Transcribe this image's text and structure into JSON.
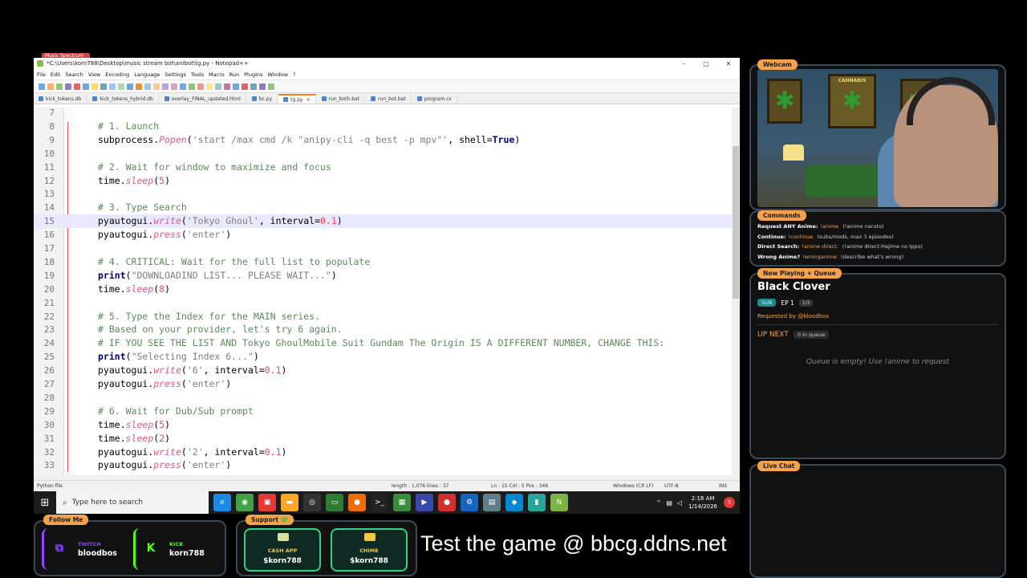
{
  "notepad": {
    "title": "*C:\\Users\\korn788\\Desktop\\music stream bot\\anibot\\tg.py - Notepad++",
    "menu": [
      "File",
      "Edit",
      "Search",
      "View",
      "Encoding",
      "Language",
      "Settings",
      "Tools",
      "Macro",
      "Run",
      "Plugins",
      "Window",
      "?"
    ],
    "tabs": [
      "kick_tokens.db",
      "kick_tokens_hybrid.db",
      "overlay_FINAL_updated.html",
      "bc.py",
      "tg.py",
      "run_both.bat",
      "run_bot.bat",
      "program.cs"
    ],
    "active_tab": "tg.py",
    "status": {
      "file_type": "Python file",
      "length": "length : 1,076    lines : 37",
      "position": "Ln : 15    Col : 5    Pos : 349",
      "eol": "Windows (CR LF)",
      "encoding": "UTF-8",
      "mode": "INS"
    }
  },
  "code": [
    {
      "n": "7",
      "parts": []
    },
    {
      "n": "8",
      "parts": [
        [
          "c-com",
          "# 1. Launch"
        ]
      ]
    },
    {
      "n": "9",
      "parts": [
        [
          "",
          "subprocess."
        ],
        [
          "c-fn",
          "Popen"
        ],
        [
          "",
          "("
        ],
        [
          "c-str",
          "'start /max cmd /k \"anipy-cli -q best -p mpv\"'"
        ],
        [
          "",
          ", shell="
        ],
        [
          "c-kw",
          "True"
        ],
        [
          "",
          ")"
        ]
      ]
    },
    {
      "n": "10",
      "parts": []
    },
    {
      "n": "11",
      "parts": [
        [
          "c-com",
          "# 2. Wait for window to maximize and focus"
        ]
      ]
    },
    {
      "n": "12",
      "parts": [
        [
          "",
          "time."
        ],
        [
          "c-fn",
          "sleep"
        ],
        [
          "",
          "("
        ],
        [
          "c-num",
          "5"
        ],
        [
          "",
          ")"
        ]
      ]
    },
    {
      "n": "13",
      "parts": []
    },
    {
      "n": "14",
      "parts": [
        [
          "c-com",
          "# 3. Type Search"
        ]
      ]
    },
    {
      "n": "15",
      "parts": [
        [
          "",
          "pyautogui."
        ],
        [
          "c-fn",
          "write"
        ],
        [
          "",
          "("
        ],
        [
          "c-str",
          "'Tokyo Ghoul'"
        ],
        [
          "",
          ", interval="
        ],
        [
          "c-num",
          "0.1"
        ],
        [
          "",
          ")"
        ]
      ],
      "current": true
    },
    {
      "n": "16",
      "parts": [
        [
          "",
          "pyautogui."
        ],
        [
          "c-fn",
          "press"
        ],
        [
          "",
          "("
        ],
        [
          "c-str",
          "'enter'"
        ],
        [
          "",
          ")"
        ]
      ]
    },
    {
      "n": "17",
      "parts": []
    },
    {
      "n": "18",
      "parts": [
        [
          "c-com",
          "# 4. CRITICAL: Wait for the full list to populate"
        ]
      ]
    },
    {
      "n": "19",
      "parts": [
        [
          "c-kw",
          "print"
        ],
        [
          "",
          "("
        ],
        [
          "c-str",
          "\"DOWNLOADIND LIST... PLEASE WAIT...\""
        ],
        [
          "",
          ")"
        ]
      ]
    },
    {
      "n": "20",
      "parts": [
        [
          "",
          "time."
        ],
        [
          "c-fn",
          "sleep"
        ],
        [
          "",
          "("
        ],
        [
          "c-num",
          "8"
        ],
        [
          "",
          ")"
        ]
      ]
    },
    {
      "n": "21",
      "parts": []
    },
    {
      "n": "22",
      "parts": [
        [
          "c-com",
          "# 5. Type the Index for the MAIN series."
        ]
      ]
    },
    {
      "n": "23",
      "parts": [
        [
          "c-com",
          "# Based on your provider, let's try 6 again."
        ]
      ]
    },
    {
      "n": "24",
      "parts": [
        [
          "c-com",
          "# IF YOU SEE THE LIST AND Tokyo GhoulMobile Suit Gundam The Origin IS A DIFFERENT NUMBER, CHANGE THIS:"
        ]
      ]
    },
    {
      "n": "25",
      "parts": [
        [
          "c-kw",
          "print"
        ],
        [
          "",
          "("
        ],
        [
          "c-str",
          "\"Selecting Index 6...\""
        ],
        [
          "",
          ")"
        ]
      ]
    },
    {
      "n": "26",
      "parts": [
        [
          "",
          "pyautogui."
        ],
        [
          "c-fn",
          "write"
        ],
        [
          "",
          "("
        ],
        [
          "c-str",
          "'6'"
        ],
        [
          "",
          ", interval="
        ],
        [
          "c-num",
          "0.1"
        ],
        [
          "",
          ")"
        ]
      ]
    },
    {
      "n": "27",
      "parts": [
        [
          "",
          "pyautogui."
        ],
        [
          "c-fn",
          "press"
        ],
        [
          "",
          "("
        ],
        [
          "c-str",
          "'enter'"
        ],
        [
          "",
          ")"
        ]
      ]
    },
    {
      "n": "28",
      "parts": []
    },
    {
      "n": "29",
      "parts": [
        [
          "c-com",
          "# 6. Wait for Dub/Sub prompt"
        ]
      ]
    },
    {
      "n": "30",
      "parts": [
        [
          "",
          "time."
        ],
        [
          "c-fn",
          "sleep"
        ],
        [
          "",
          "("
        ],
        [
          "c-num",
          "5"
        ],
        [
          "",
          ")"
        ]
      ]
    },
    {
      "n": "31",
      "parts": [
        [
          "",
          "time."
        ],
        [
          "c-fn",
          "sleep"
        ],
        [
          "",
          "("
        ],
        [
          "c-num",
          "2"
        ],
        [
          "",
          ")"
        ]
      ]
    },
    {
      "n": "32",
      "parts": [
        [
          "",
          "pyautogui."
        ],
        [
          "c-fn",
          "write"
        ],
        [
          "",
          "("
        ],
        [
          "c-str",
          "'2'"
        ],
        [
          "",
          ", interval="
        ],
        [
          "c-num",
          "0.1"
        ],
        [
          "",
          ")"
        ]
      ]
    },
    {
      "n": "33",
      "parts": [
        [
          "",
          "pyautogui."
        ],
        [
          "c-fn",
          "press"
        ],
        [
          "",
          "("
        ],
        [
          "c-str",
          "'enter'"
        ],
        [
          "",
          ")"
        ]
      ]
    }
  ],
  "taskbar": {
    "search_placeholder": "Type here to search",
    "time": "2:18 AM",
    "date": "1/14/2026",
    "notifications": "5",
    "apps": [
      {
        "name": "edge-icon",
        "color": "#1e88e5",
        "glyph": "e"
      },
      {
        "name": "chrome-icon",
        "color": "#43a047",
        "glyph": "◉"
      },
      {
        "name": "store-icon",
        "color": "#e53935",
        "glyph": "▣"
      },
      {
        "name": "folder-icon",
        "color": "#f9a825",
        "glyph": "▬"
      },
      {
        "name": "obs-icon",
        "color": "#333333",
        "glyph": "◎"
      },
      {
        "name": "monitor-icon",
        "color": "#2e7d32",
        "glyph": "▭"
      },
      {
        "name": "firefox-icon",
        "color": "#ef6c00",
        "glyph": "●"
      },
      {
        "name": "terminal-icon",
        "color": "#222222",
        "glyph": ">_"
      },
      {
        "name": "app-icon",
        "color": "#388e3c",
        "glyph": "▦"
      },
      {
        "name": "media-icon",
        "color": "#3949ab",
        "glyph": "▶"
      },
      {
        "name": "record-icon",
        "color": "#d32f2f",
        "glyph": "●"
      },
      {
        "name": "steam-icon",
        "color": "#1565c0",
        "glyph": "⚙"
      },
      {
        "name": "drive-icon",
        "color": "#607d8b",
        "glyph": "▤"
      },
      {
        "name": "vpn-icon",
        "color": "#0288d1",
        "glyph": "◆"
      },
      {
        "name": "notes-icon",
        "color": "#26a69a",
        "glyph": "▮"
      },
      {
        "name": "notepadpp-icon",
        "color": "#7cb342",
        "glyph": "N"
      }
    ]
  },
  "overlay": {
    "webcam_tag": "Webcam",
    "poster_text": "CANNABIS",
    "commands_tag": "Commands",
    "commands": [
      {
        "label": "Request ANY Anime:",
        "cmd": "!anime",
        "desc": "(!anime naruto)"
      },
      {
        "label": "Continue:",
        "cmd": "!continue",
        "desc": "(subs/mods, max 3 episodes)"
      },
      {
        "label": "Direct Search:",
        "cmd": "!anime direct:",
        "desc": "(!anime direct:Hajime no Ippo)"
      },
      {
        "label": "Wrong Anime?",
        "cmd": "!wronganime",
        "desc": "(describe what's wrong)"
      }
    ],
    "nowplaying_tag": "Now Playing + Queue",
    "now_title": "Black Clover",
    "sub_badge": "SUB",
    "episode": "EP 1",
    "episode_of": "1/3",
    "requested_by": "Requested by @bloodbos",
    "up_next": "UP NEXT",
    "queue_count": "0 in queue",
    "queue_empty": "Queue is empty! Use !anime to request",
    "livechat_tag": "Live Chat",
    "follow_tag": "Follow Me",
    "follow": [
      {
        "platform": "TWITCH",
        "handle": "bloodbos",
        "color": "#9146ff",
        "glyph": "⧉"
      },
      {
        "platform": "KICK",
        "handle": "korn788",
        "color": "#53fc18",
        "glyph": "K"
      }
    ],
    "support_tag": "Support 💚",
    "support": [
      {
        "label": "CASH APP",
        "cashtag": "$korn788",
        "color": "#d9e1a0"
      },
      {
        "label": "CHIME",
        "cashtag": "$korn788",
        "color": "#f5c842"
      }
    ],
    "banner": "Test the game @ bbcg.ddns.net",
    "music_tag": "Music Spectrum"
  }
}
